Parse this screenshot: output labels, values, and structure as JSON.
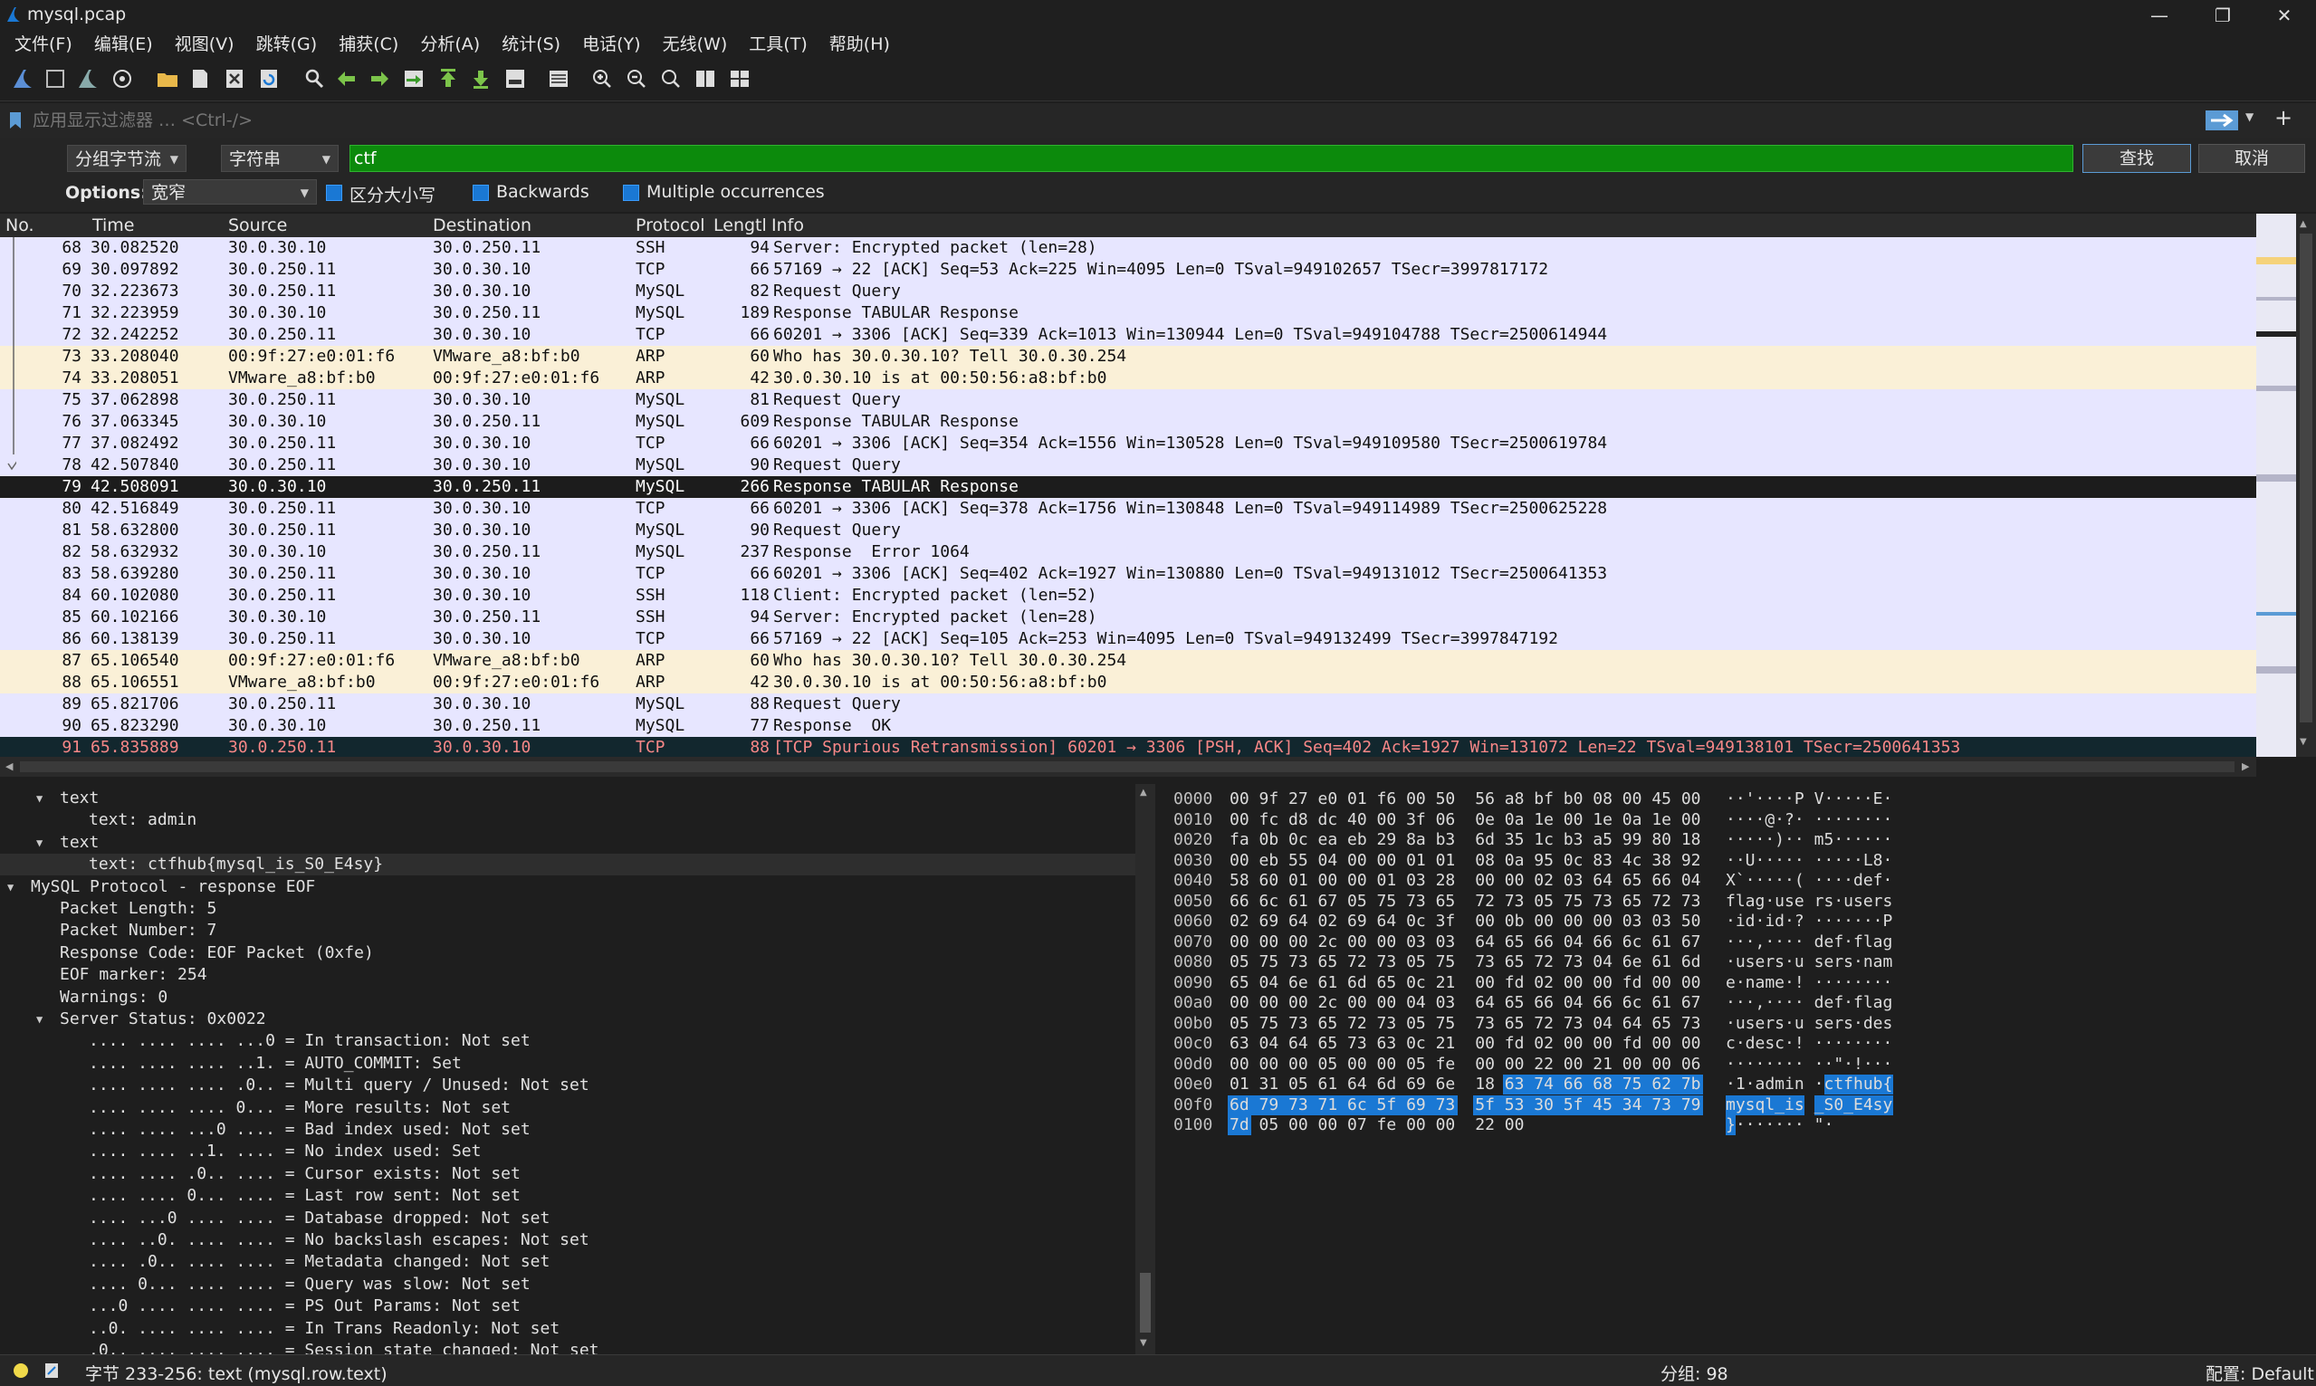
{
  "window": {
    "title": "mysql.pcap"
  },
  "menu": [
    "文件(F)",
    "编辑(E)",
    "视图(V)",
    "跳转(G)",
    "捕获(C)",
    "分析(A)",
    "统计(S)",
    "电话(Y)",
    "无线(W)",
    "工具(T)",
    "帮助(H)"
  ],
  "filter": {
    "placeholder": "应用显示过滤器 … <Ctrl-/>"
  },
  "find": {
    "search_in": "分组字节流",
    "search_type": "字符串",
    "query": "ctf",
    "find_label": "查找",
    "cancel_label": "取消",
    "options_label": "Options:",
    "charset": "宽窄",
    "case_label": "区分大小写",
    "backwards_label": "Backwards",
    "multiple_label": "Multiple occurrences"
  },
  "columns": {
    "no": "No.",
    "time": "Time",
    "source": "Source",
    "destination": "Destination",
    "protocol": "Protocol",
    "length": "Lengtl",
    "info": "Info"
  },
  "packets": [
    {
      "no": "68",
      "time": "30.082520",
      "src": "30.0.30.10",
      "dst": "30.0.250.11",
      "proto": "SSH",
      "len": "94",
      "info": "Server: Encrypted packet (len=28)",
      "cls": "tcp"
    },
    {
      "no": "69",
      "time": "30.097892",
      "src": "30.0.250.11",
      "dst": "30.0.30.10",
      "proto": "TCP",
      "len": "66",
      "info": "57169 → 22 [ACK] Seq=53 Ack=225 Win=4095 Len=0 TSval=949102657 TSecr=3997817172",
      "cls": "tcp"
    },
    {
      "no": "70",
      "time": "32.223673",
      "src": "30.0.250.11",
      "dst": "30.0.30.10",
      "proto": "MySQL",
      "len": "82",
      "info": "Request Query",
      "cls": "tcp"
    },
    {
      "no": "71",
      "time": "32.223959",
      "src": "30.0.30.10",
      "dst": "30.0.250.11",
      "proto": "MySQL",
      "len": "189",
      "info": "Response TABULAR Response",
      "cls": "tcp"
    },
    {
      "no": "72",
      "time": "32.242252",
      "src": "30.0.250.11",
      "dst": "30.0.30.10",
      "proto": "TCP",
      "len": "66",
      "info": "60201 → 3306 [ACK] Seq=339 Ack=1013 Win=130944 Len=0 TSval=949104788 TSecr=2500614944",
      "cls": "tcp"
    },
    {
      "no": "73",
      "time": "33.208040",
      "src": "00:9f:27:e0:01:f6",
      "dst": "VMware_a8:bf:b0",
      "proto": "ARP",
      "len": "60",
      "info": "Who has 30.0.30.10? Tell 30.0.30.254",
      "cls": "arp"
    },
    {
      "no": "74",
      "time": "33.208051",
      "src": "VMware_a8:bf:b0",
      "dst": "00:9f:27:e0:01:f6",
      "proto": "ARP",
      "len": "42",
      "info": "30.0.30.10 is at 00:50:56:a8:bf:b0",
      "cls": "arp"
    },
    {
      "no": "75",
      "time": "37.062898",
      "src": "30.0.250.11",
      "dst": "30.0.30.10",
      "proto": "MySQL",
      "len": "81",
      "info": "Request Query",
      "cls": "tcp"
    },
    {
      "no": "76",
      "time": "37.063345",
      "src": "30.0.30.10",
      "dst": "30.0.250.11",
      "proto": "MySQL",
      "len": "609",
      "info": "Response TABULAR Response",
      "cls": "tcp"
    },
    {
      "no": "77",
      "time": "37.082492",
      "src": "30.0.250.11",
      "dst": "30.0.30.10",
      "proto": "TCP",
      "len": "66",
      "info": "60201 → 3306 [ACK] Seq=354 Ack=1556 Win=130528 Len=0 TSval=949109580 TSecr=2500619784",
      "cls": "tcp"
    },
    {
      "no": "78",
      "time": "42.507840",
      "src": "30.0.250.11",
      "dst": "30.0.30.10",
      "proto": "MySQL",
      "len": "90",
      "info": "Request Query",
      "cls": "tcp"
    },
    {
      "no": "79",
      "time": "42.508091",
      "src": "30.0.30.10",
      "dst": "30.0.250.11",
      "proto": "MySQL",
      "len": "266",
      "info": "Response TABULAR Response",
      "cls": "sel"
    },
    {
      "no": "80",
      "time": "42.516849",
      "src": "30.0.250.11",
      "dst": "30.0.30.10",
      "proto": "TCP",
      "len": "66",
      "info": "60201 → 3306 [ACK] Seq=378 Ack=1756 Win=130848 Len=0 TSval=949114989 TSecr=2500625228",
      "cls": "tcp"
    },
    {
      "no": "81",
      "time": "58.632800",
      "src": "30.0.250.11",
      "dst": "30.0.30.10",
      "proto": "MySQL",
      "len": "90",
      "info": "Request Query",
      "cls": "tcp"
    },
    {
      "no": "82",
      "time": "58.632932",
      "src": "30.0.30.10",
      "dst": "30.0.250.11",
      "proto": "MySQL",
      "len": "237",
      "info": "Response  Error 1064",
      "cls": "tcp"
    },
    {
      "no": "83",
      "time": "58.639280",
      "src": "30.0.250.11",
      "dst": "30.0.30.10",
      "proto": "TCP",
      "len": "66",
      "info": "60201 → 3306 [ACK] Seq=402 Ack=1927 Win=130880 Len=0 TSval=949131012 TSecr=2500641353",
      "cls": "tcp"
    },
    {
      "no": "84",
      "time": "60.102080",
      "src": "30.0.250.11",
      "dst": "30.0.30.10",
      "proto": "SSH",
      "len": "118",
      "info": "Client: Encrypted packet (len=52)",
      "cls": "tcp"
    },
    {
      "no": "85",
      "time": "60.102166",
      "src": "30.0.30.10",
      "dst": "30.0.250.11",
      "proto": "SSH",
      "len": "94",
      "info": "Server: Encrypted packet (len=28)",
      "cls": "tcp"
    },
    {
      "no": "86",
      "time": "60.138139",
      "src": "30.0.250.11",
      "dst": "30.0.30.10",
      "proto": "TCP",
      "len": "66",
      "info": "57169 → 22 [ACK] Seq=105 Ack=253 Win=4095 Len=0 TSval=949132499 TSecr=3997847192",
      "cls": "tcp"
    },
    {
      "no": "87",
      "time": "65.106540",
      "src": "00:9f:27:e0:01:f6",
      "dst": "VMware_a8:bf:b0",
      "proto": "ARP",
      "len": "60",
      "info": "Who has 30.0.30.10? Tell 30.0.30.254",
      "cls": "arp"
    },
    {
      "no": "88",
      "time": "65.106551",
      "src": "VMware_a8:bf:b0",
      "dst": "00:9f:27:e0:01:f6",
      "proto": "ARP",
      "len": "42",
      "info": "30.0.30.10 is at 00:50:56:a8:bf:b0",
      "cls": "arp"
    },
    {
      "no": "89",
      "time": "65.821706",
      "src": "30.0.250.11",
      "dst": "30.0.30.10",
      "proto": "MySQL",
      "len": "88",
      "info": "Request Query",
      "cls": "tcp"
    },
    {
      "no": "90",
      "time": "65.823290",
      "src": "30.0.30.10",
      "dst": "30.0.250.11",
      "proto": "MySQL",
      "len": "77",
      "info": "Response  OK",
      "cls": "tcp"
    },
    {
      "no": "91",
      "time": "65.835889",
      "src": "30.0.250.11",
      "dst": "30.0.30.10",
      "proto": "TCP",
      "len": "88",
      "info": "[TCP Spurious Retransmission] 60201 → 3306 [PSH, ACK] Seq=402 Ack=1927 Win=131072 Len=22 TSval=949138101 TSecr=2500641353",
      "cls": "ret"
    }
  ],
  "details": [
    {
      "text": "text",
      "indent": 2,
      "tw": "open"
    },
    {
      "text": "text: admin",
      "indent": 3
    },
    {
      "text": "text",
      "indent": 2,
      "tw": "open"
    },
    {
      "text": "text: ctfhub{mysql_is_S0_E4sy}",
      "indent": 3,
      "hl": true
    },
    {
      "text": "MySQL Protocol - response EOF",
      "indent": 1,
      "tw": "open"
    },
    {
      "text": "Packet Length: 5",
      "indent": 2
    },
    {
      "text": "Packet Number: 7",
      "indent": 2
    },
    {
      "text": "Response Code: EOF Packet (0xfe)",
      "indent": 2
    },
    {
      "text": "EOF marker: 254",
      "indent": 2
    },
    {
      "text": "Warnings: 0",
      "indent": 2
    },
    {
      "text": "Server Status: 0x0022",
      "indent": 2,
      "tw": "open"
    },
    {
      "text": ".... .... .... ...0 = In transaction: Not set",
      "indent": 3
    },
    {
      "text": ".... .... .... ..1. = AUTO_COMMIT: Set",
      "indent": 3
    },
    {
      "text": ".... .... .... .0.. = Multi query / Unused: Not set",
      "indent": 3
    },
    {
      "text": ".... .... .... 0... = More results: Not set",
      "indent": 3
    },
    {
      "text": ".... .... ...0 .... = Bad index used: Not set",
      "indent": 3
    },
    {
      "text": ".... .... ..1. .... = No index used: Set",
      "indent": 3
    },
    {
      "text": ".... .... .0.. .... = Cursor exists: Not set",
      "indent": 3
    },
    {
      "text": ".... .... 0... .... = Last row sent: Not set",
      "indent": 3
    },
    {
      "text": ".... ...0 .... .... = Database dropped: Not set",
      "indent": 3
    },
    {
      "text": ".... ..0. .... .... = No backslash escapes: Not set",
      "indent": 3
    },
    {
      "text": ".... .0.. .... .... = Metadata changed: Not set",
      "indent": 3
    },
    {
      "text": ".... 0... .... .... = Query was slow: Not set",
      "indent": 3
    },
    {
      "text": "...0 .... .... .... = PS Out Params: Not set",
      "indent": 3
    },
    {
      "text": "..0. .... .... .... = In Trans Readonly: Not set",
      "indent": 3
    },
    {
      "text": ".0.. .... .... .... = Session state changed: Not set",
      "indent": 3
    }
  ],
  "bytes": [
    {
      "off": "0000",
      "h1": "00 9f 27 e0 01 f6 00 50",
      "h2": "56 a8 bf b0 08 00 45 00",
      "a1": "··'····P",
      "a2": "V·····E·"
    },
    {
      "off": "0010",
      "h1": "00 fc d8 dc 40 00 3f 06",
      "h2": "0e 0a 1e 00 1e 0a 1e 00",
      "a1": "····@·?·",
      "a2": "········"
    },
    {
      "off": "0020",
      "h1": "fa 0b 0c ea eb 29 8a b3",
      "h2": "6d 35 1c b3 a5 99 80 18",
      "a1": "·····)··",
      "a2": "m5······"
    },
    {
      "off": "0030",
      "h1": "00 eb 55 04 00 00 01 01",
      "h2": "08 0a 95 0c 83 4c 38 92",
      "a1": "··U·····",
      "a2": "·····L8·"
    },
    {
      "off": "0040",
      "h1": "58 60 01 00 00 01 03 28",
      "h2": "00 00 02 03 64 65 66 04",
      "a1": "X`·····(",
      "a2": "····def·"
    },
    {
      "off": "0050",
      "h1": "66 6c 61 67 05 75 73 65",
      "h2": "72 73 05 75 73 65 72 73",
      "a1": "flag·use",
      "a2": "rs·users"
    },
    {
      "off": "0060",
      "h1": "02 69 64 02 69 64 0c 3f",
      "h2": "00 0b 00 00 00 03 03 50",
      "a1": "·id·id·?",
      "a2": "·······P"
    },
    {
      "off": "0070",
      "h1": "00 00 00 2c 00 00 03 03",
      "h2": "64 65 66 04 66 6c 61 67",
      "a1": "···,····",
      "a2": "def·flag"
    },
    {
      "off": "0080",
      "h1": "05 75 73 65 72 73 05 75",
      "h2": "73 65 72 73 04 6e 61 6d",
      "a1": "·users·u",
      "a2": "sers·nam"
    },
    {
      "off": "0090",
      "h1": "65 04 6e 61 6d 65 0c 21",
      "h2": "00 fd 02 00 00 fd 00 00",
      "a1": "e·name·!",
      "a2": "········"
    },
    {
      "off": "00a0",
      "h1": "00 00 00 2c 00 00 04 03",
      "h2": "64 65 66 04 66 6c 61 67",
      "a1": "···,····",
      "a2": "def·flag"
    },
    {
      "off": "00b0",
      "h1": "05 75 73 65 72 73 05 75",
      "h2": "73 65 72 73 04 64 65 73",
      "a1": "·users·u",
      "a2": "sers·des"
    },
    {
      "off": "00c0",
      "h1": "63 04 64 65 73 63 0c 21",
      "h2": "00 fd 02 00 00 fd 00 00",
      "a1": "c·desc·!",
      "a2": "········"
    },
    {
      "off": "00d0",
      "h1": "00 00 00 05 00 00 05 fe",
      "h2": "00 00 22 00 21 00 00 06",
      "a1": "········",
      "a2": "··\"·!···"
    },
    {
      "off": "00e0",
      "h1": "01 31 05 61 64 6d 69 6e",
      "h2": "18 63 74 66 68 75 62 7b",
      "a1": "·1·admin",
      "a2": "·ctfhub{"
    },
    {
      "off": "00f0",
      "h1": "6d 79 73 71 6c 5f 69 73",
      "h2": "5f 53 30 5f 45 34 73 79",
      "a1": "mysql_is",
      "a2": "_S0_E4sy"
    },
    {
      "off": "0100",
      "h1": "7d 05 00 00 07 fe 00 00",
      "h2": "22 00",
      "a1": "}·······",
      "a2": "\"·"
    }
  ],
  "status": {
    "field": "字节 233-256: text (mysql.row.text)",
    "packets": "分组: 98",
    "profile": "配置: Default"
  }
}
